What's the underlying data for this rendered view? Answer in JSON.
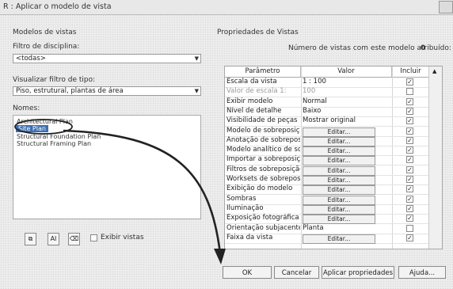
{
  "window": {
    "title": "R : Aplicar o modelo de vista"
  },
  "left": {
    "section_label": "Modelos de vistas",
    "discipline_label": "Filtro de disciplina:",
    "discipline_value": "<todas>",
    "viewtype_label": "Visualizar filtro de tipo:",
    "viewtype_value": "Piso, estrutural, plantas de área",
    "names_label": "Nomes:",
    "items": [
      "Architectural Plan",
      "Site Plan",
      "Structural Foundation Plan",
      "Structural Framing Plan"
    ],
    "selected_index": 1,
    "show_views_label": "Exibir vistas",
    "show_views_checked": false
  },
  "right": {
    "section_label": "Propriedades de Vistas",
    "count_label": "Número de vistas com este modelo atribuído:",
    "count_value": "0",
    "columns": [
      "Parâmetro",
      "Valor",
      "Incluir"
    ],
    "rows": [
      {
        "param": "Escala da vista",
        "value": "1 : 100",
        "include": true,
        "dim": false
      },
      {
        "param": "Valor de escala   1:",
        "value": "100",
        "include": false,
        "dim": true
      },
      {
        "param": "Exibir modelo",
        "value": "Normal",
        "include": true,
        "dim": false
      },
      {
        "param": "Nível de detalhe",
        "value": "Baixo",
        "include": true,
        "dim": false
      },
      {
        "param": "Visibilidade de peças",
        "value": "Mostrar original",
        "include": true,
        "dim": false
      },
      {
        "param": "Modelo de sobreposição",
        "value": "Editar...",
        "include": true,
        "dim": false,
        "button": true
      },
      {
        "param": "Anotação de sobreposição",
        "value": "Editar...",
        "include": true,
        "dim": false,
        "button": true
      },
      {
        "param": "Modelo analítico de sobreposição",
        "value": "Editar...",
        "include": true,
        "dim": false,
        "button": true
      },
      {
        "param": "Importar a sobreposição",
        "value": "Editar...",
        "include": true,
        "dim": false,
        "button": true
      },
      {
        "param": "Filtros de sobreposição",
        "value": "Editar...",
        "include": true,
        "dim": false,
        "button": true
      },
      {
        "param": "Worksets de sobreposição",
        "value": "Editar...",
        "include": true,
        "dim": false,
        "button": true
      },
      {
        "param": "Exibição do modelo",
        "value": "Editar...",
        "include": true,
        "dim": false,
        "button": true
      },
      {
        "param": "Sombras",
        "value": "Editar...",
        "include": true,
        "dim": false,
        "button": true
      },
      {
        "param": "Iluminação",
        "value": "Editar...",
        "include": true,
        "dim": false,
        "button": true
      },
      {
        "param": "Exposição fotográfica",
        "value": "Editar...",
        "include": true,
        "dim": false,
        "button": true
      },
      {
        "param": "Orientação subjacente",
        "value": "Planta",
        "include": false,
        "dim": false
      },
      {
        "param": "Faixa da vista",
        "value": "Editar...",
        "include": true,
        "dim": false,
        "button": true
      }
    ]
  },
  "buttons": {
    "ok": "OK",
    "cancel": "Cancelar",
    "apply": "Aplicar propriedades",
    "help": "Ajuda..."
  }
}
